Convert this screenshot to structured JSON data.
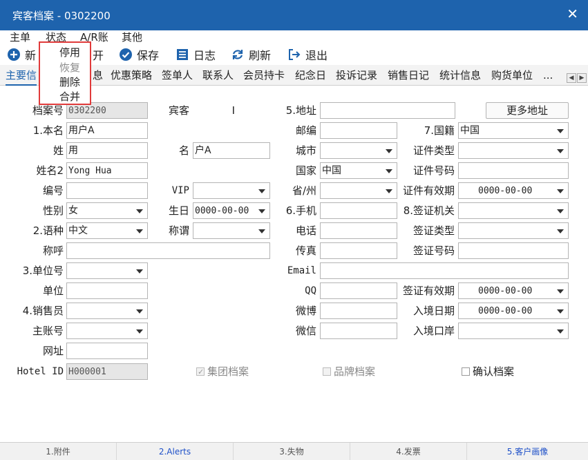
{
  "window": {
    "title": "宾客档案 - 0302200"
  },
  "menubar": {
    "main": "主单",
    "status": "状态",
    "ar": "A/R账",
    "other": "其他"
  },
  "status_menu": {
    "items": [
      "停用",
      "恢复",
      "删除",
      "合并"
    ]
  },
  "toolbar": {
    "new": "新",
    "open": "开",
    "save": "保存",
    "log": "日志",
    "refresh": "刷新",
    "exit": "退出"
  },
  "tabs": {
    "main": "主要信",
    "items": [
      "息",
      "优惠策略",
      "签单人",
      "联系人",
      "会员持卡",
      "纪念日",
      "投诉记录",
      "销售日记",
      "统计信息",
      "购货单位",
      "..."
    ]
  },
  "form": {
    "labels": {
      "file_no": "档案号",
      "guest": "宾客",
      "address": "5.地址",
      "real_name": "1.本名",
      "postcode": "邮编",
      "nationality": "7.国籍",
      "surname": "姓",
      "given_name": "名",
      "city": "城市",
      "id_type": "证件类型",
      "name2": "姓名2",
      "country": "国家",
      "id_no": "证件号码",
      "code": "编号",
      "vip": "VIP",
      "province": "省/州",
      "id_valid": "证件有效期",
      "gender": "性别",
      "birthday": "生日",
      "mobile": "6.手机",
      "visa_office": "8.签证机关",
      "language": "2.语种",
      "title_call": "称谓",
      "phone": "电话",
      "visa_type": "签证类型",
      "salutation": "称呼",
      "fax": "传真",
      "visa_no": "签证号码",
      "unit_no": "3.单位号",
      "email": "Email",
      "unit": "单位",
      "qq": "QQ",
      "visa_valid": "签证有效期",
      "sales": "4.销售员",
      "weibo": "微博",
      "entry_date": "入境日期",
      "master_acct": "主账号",
      "wechat": "微信",
      "entry_port": "入境口岸",
      "website": "网址",
      "hotel_id": "Hotel ID"
    },
    "values": {
      "file_no": "0302200",
      "guest_type": "I",
      "real_name": "用户A",
      "nationality": "中国",
      "surname": "用",
      "given_name": "户A",
      "name2": "Yong Hua",
      "country": "中国",
      "id_valid": "0000-00-00",
      "gender": "女",
      "birthday": "0000-00-00",
      "language": "中文",
      "visa_valid": "0000-00-00",
      "entry_date": "0000-00-00",
      "hotel_id": "H000001"
    },
    "more_address_button": "更多地址",
    "checkboxes": {
      "group": "集团档案",
      "brand": "品牌档案",
      "confirm": "确认档案"
    }
  },
  "bottom_tabs": [
    "1.附件",
    "2.Alerts",
    "3.失物",
    "4.发票",
    "5.客户画像"
  ]
}
